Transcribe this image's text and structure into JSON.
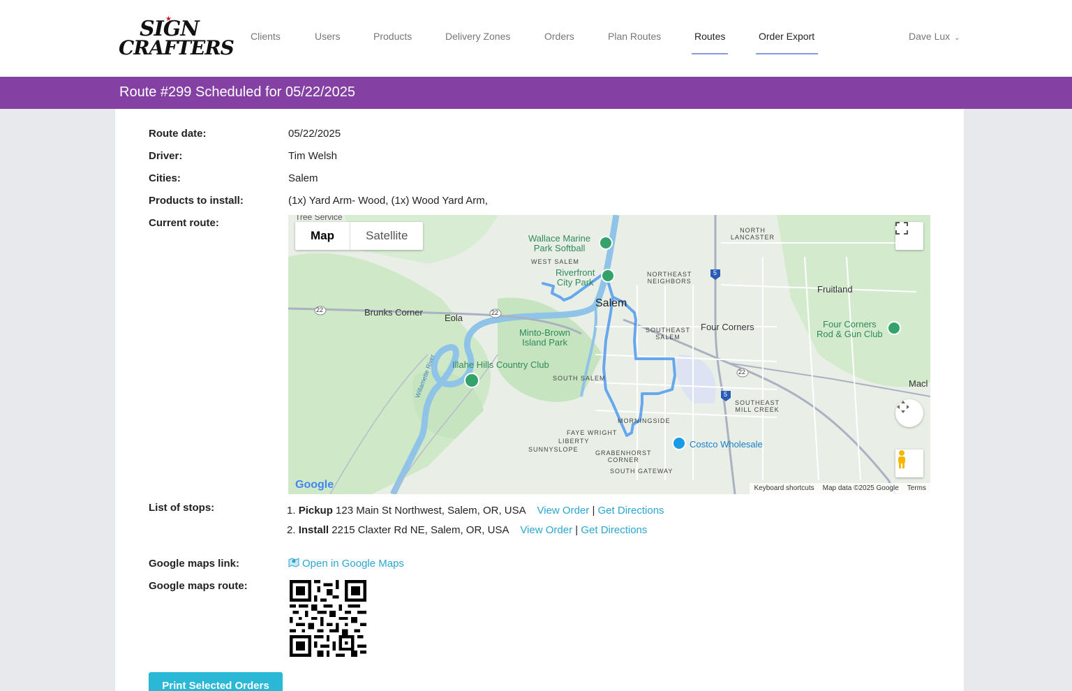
{
  "logo": {
    "line1": "SIGN",
    "line2": "CRAFTERS"
  },
  "nav": {
    "items": [
      {
        "label": "Clients",
        "active": false
      },
      {
        "label": "Users",
        "active": false
      },
      {
        "label": "Products",
        "active": false
      },
      {
        "label": "Delivery Zones",
        "active": false
      },
      {
        "label": "Orders",
        "active": false
      },
      {
        "label": "Plan Routes",
        "active": false
      },
      {
        "label": "Routes",
        "active": true
      },
      {
        "label": "Order Export",
        "active": true
      }
    ],
    "user": "Dave Lux"
  },
  "banner": {
    "title": "Route #299 Scheduled for 05/22/2025"
  },
  "details": {
    "route_date_label": "Route date:",
    "route_date": "05/22/2025",
    "driver_label": "Driver:",
    "driver": "Tim Welsh",
    "cities_label": "Cities:",
    "cities": "Salem",
    "products_label": "Products to install:",
    "products": "(1x) Yard Arm- Wood, (1x) Wood Yard Arm,",
    "current_route_label": "Current route:",
    "stops_label": "List of stops:",
    "maps_link_label": "Google maps link:",
    "maps_route_label": "Google maps route:"
  },
  "map": {
    "type_map": "Map",
    "type_satellite": "Satellite",
    "places": {
      "tree_service": "Tree Service",
      "wallace": "Wallace Marine",
      "wallace2": "Park Softball",
      "west_salem": "WEST SALEM",
      "riverfront": "Riverfront",
      "riverfront2": "City Park",
      "northeast": "NORTHEAST",
      "northeast2": "NEIGHBORS",
      "north_lancaster": "NORTH",
      "north_lancaster2": "LANCASTER",
      "salem": "Salem",
      "brunks": "Brunks Corner",
      "eola": "Eola",
      "fruitland": "Fruitland",
      "four_corners": "Four Corners",
      "four_corners_rod": "Four Corners",
      "four_corners_rod2": "Rod & Gun Club",
      "southeast": "SOUTHEAST",
      "southeast2": "SALEM",
      "minto": "Minto-Brown",
      "minto2": "Island Park",
      "illahe": "Illahe Hills Country Club",
      "south_salem": "SOUTH SALEM",
      "macl": "Macl",
      "southeast_mill": "SOUTHEAST",
      "southeast_mill2": "MILL CREEK",
      "morningside": "MORNINGSIDE",
      "faye": "FAYE WRIGHT",
      "liberty": "LIBERTY",
      "sunnyslope": "SUNNYSLOPE",
      "grabenhorst": "GRABENHORST",
      "grabenhorst2": "CORNER",
      "costco": "Costco Wholesale",
      "south_gateway": "SOUTH GATEWAY",
      "willamette": "Willamette River"
    },
    "shields": {
      "r22a": "22",
      "r22b": "22",
      "r22c": "22",
      "i5a": "5",
      "i5b": "5"
    },
    "google": "Google",
    "footer_shortcuts": "Keyboard shortcuts",
    "footer_data": "Map data ©2025 Google",
    "footer_terms": "Terms",
    "colors": {
      "route": "#3b8ff0",
      "park": "#c9e6c4",
      "water": "#9ccbe9",
      "road": "#ffffff"
    }
  },
  "stops": [
    {
      "num": "1.",
      "type": "Pickup",
      "address": "123 Main St Northwest, Salem, OR, USA",
      "view": "View Order",
      "sep": "|",
      "directions": "Get Directions"
    },
    {
      "num": "2.",
      "type": "Install",
      "address": "2215 Claxter Rd NE, Salem, OR, USA",
      "view": "View Order",
      "sep": "|",
      "directions": "Get Directions"
    }
  ],
  "gmaps_link_text": "Open in Google Maps",
  "print_button": "Print Selected Orders"
}
